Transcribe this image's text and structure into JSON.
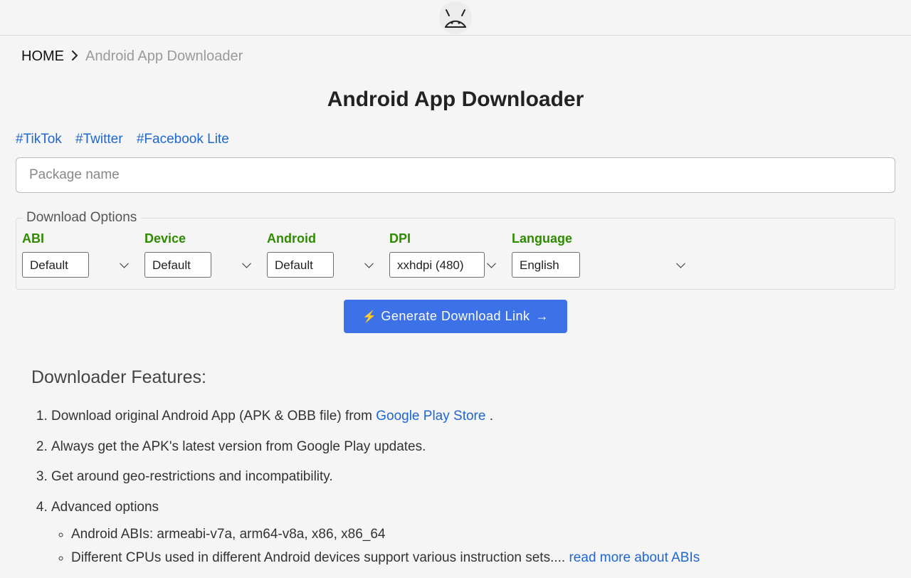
{
  "breadcrumb": {
    "home": "HOME",
    "current": "Android App Downloader"
  },
  "title": "Android App Downloader",
  "hashtags": [
    "#TikTok",
    "#Twitter",
    "#Facebook Lite"
  ],
  "search": {
    "placeholder": "Package name",
    "value": ""
  },
  "options": {
    "legend": "Download Options",
    "fields": [
      {
        "label": "ABI",
        "value": "Default",
        "width": "narrow"
      },
      {
        "label": "Device",
        "value": "Default",
        "width": "narrow"
      },
      {
        "label": "Android",
        "value": "Default",
        "width": "narrow"
      },
      {
        "label": "DPI",
        "value": "xxhdpi (480)",
        "width": "narrow"
      },
      {
        "label": "Language",
        "value": "English",
        "width": "wide"
      }
    ]
  },
  "generate_label": "Generate Download Link",
  "features": {
    "heading": "Downloader Features:",
    "items": {
      "i1_a": "Download original Android App (APK & OBB file) from ",
      "i1_link": "Google Play Store",
      "i1_b": " .",
      "i2": "Always get the APK's latest version from Google Play updates.",
      "i3": "Get around geo-restrictions and incompatibility.",
      "i4": "Advanced options",
      "sub1": "Android ABIs: armeabi-v7a, arm64-v8a, x86, x86_64",
      "sub2a": "Different CPUs used in different Android devices support various instruction sets.... ",
      "sub2link": "read more about ABIs"
    }
  }
}
